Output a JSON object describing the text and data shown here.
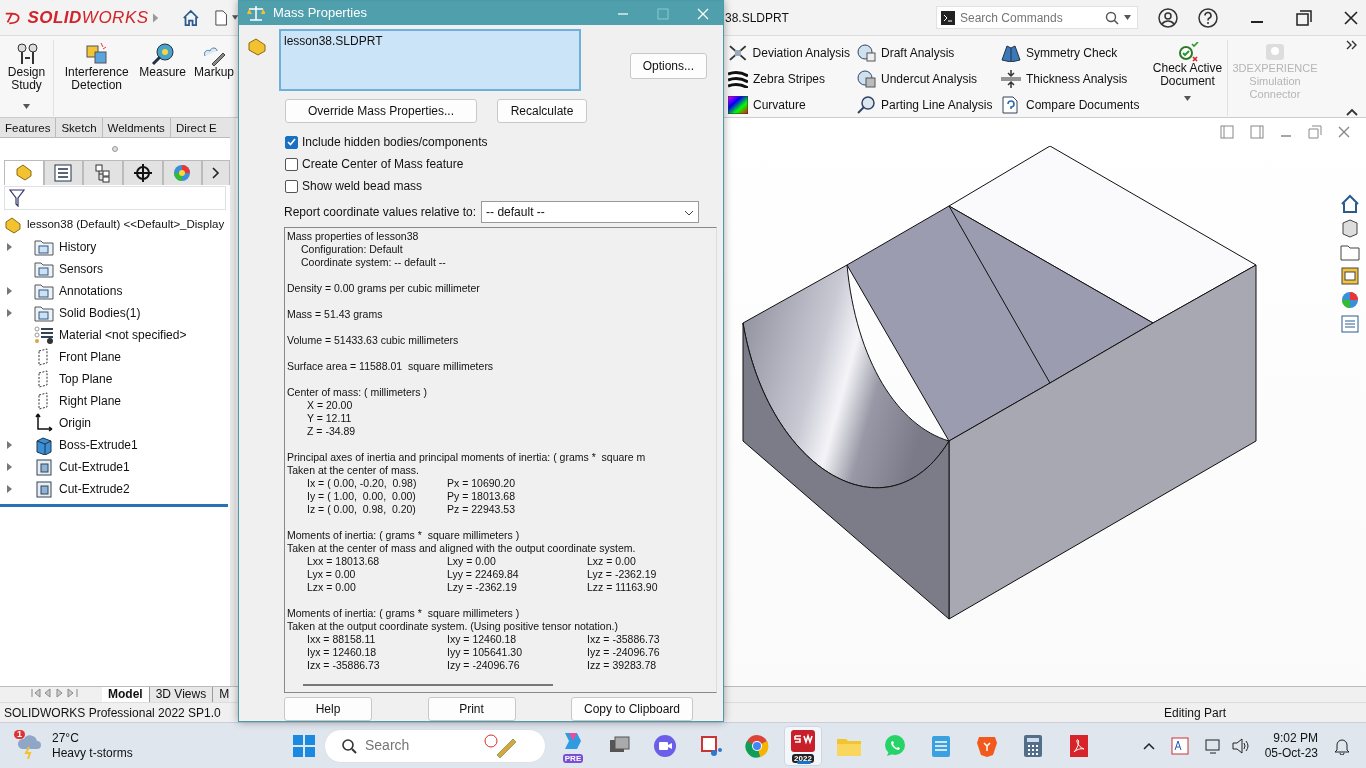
{
  "app": {
    "logo": "**SOLID**WORKS",
    "document_title": "38.SLDPRT",
    "search": {
      "placeholder": "Search Commands"
    }
  },
  "ribbon_left": [
    {
      "label": "Design Study",
      "dropdown": true
    },
    {
      "label": "Interference Detection",
      "dropdown": false
    },
    {
      "label": "Measure",
      "dropdown": false
    },
    {
      "label": "Markup",
      "dropdown": false
    }
  ],
  "ribbon_right": {
    "items": [
      "Deviation Analysis",
      "Zebra Stripes",
      "Curvature",
      "Draft Analysis",
      "Undercut Analysis",
      "Parting Line Analysis",
      "Symmetry Check",
      "Thickness Analysis",
      "Compare Documents"
    ],
    "check": {
      "label": "Check Active Document",
      "dropdown": true
    },
    "connector": {
      "label": "3DEXPERIENCE Simulation Connector",
      "disabled": true
    }
  },
  "command_tabs": [
    {
      "label": "Features",
      "selected": false
    },
    {
      "label": "Sketch",
      "selected": false
    },
    {
      "label": "Weldments",
      "selected": false
    },
    {
      "label": "Direct E",
      "selected": false
    }
  ],
  "tree_tabs": [
    {
      "selected": true
    },
    {
      "selected": false
    },
    {
      "selected": false
    },
    {
      "selected": false
    },
    {
      "selected": false
    }
  ],
  "feature_tree": {
    "root": "lesson38 (Default) <<Default>_Display",
    "items": [
      {
        "label": "History",
        "kind": "folder",
        "expandable": true
      },
      {
        "label": "Sensors",
        "kind": "folder",
        "expandable": false
      },
      {
        "label": "Annotations",
        "kind": "folder",
        "expandable": true
      },
      {
        "label": "Solid Bodies(1)",
        "kind": "folder",
        "expandable": true
      },
      {
        "label": "Material <not specified>",
        "kind": "material",
        "expandable": false
      },
      {
        "label": "Front Plane",
        "kind": "plane",
        "expandable": false
      },
      {
        "label": "Top Plane",
        "kind": "plane",
        "expandable": false
      },
      {
        "label": "Right Plane",
        "kind": "plane",
        "expandable": false
      },
      {
        "label": "Origin",
        "kind": "origin",
        "expandable": false
      },
      {
        "label": "Boss-Extrude1",
        "kind": "boss",
        "expandable": true
      },
      {
        "label": "Cut-Extrude1",
        "kind": "cut",
        "expandable": true
      },
      {
        "label": "Cut-Extrude2",
        "kind": "cut",
        "expandable": true
      }
    ]
  },
  "bottom_tabs": [
    {
      "label": "Model",
      "selected": true
    },
    {
      "label": "3D Views",
      "selected": false
    },
    {
      "label": "M",
      "selected": false
    }
  ],
  "status_bar": {
    "product": "SOLIDWORKS Professional 2022 SP1.0",
    "mode": "Editing Part"
  },
  "dialog": {
    "title": "Mass Properties",
    "selected_items": [
      "lesson38.SLDPRT"
    ],
    "options_button": "Options...",
    "override_button": "Override Mass Properties...",
    "recalculate_button": "Recalculate",
    "checkboxes": [
      {
        "label": "Include hidden bodies/components",
        "checked": true
      },
      {
        "label": "Create Center of Mass feature",
        "checked": false
      },
      {
        "label": "Show weld bead mass",
        "checked": false
      }
    ],
    "coordinate": {
      "label": "Report coordinate values relative to:",
      "value": "-- default --"
    },
    "report": [
      {
        "heading": [
          "Mass properties of lesson38"
        ],
        "rows": [
          [
            "Configuration: Default"
          ],
          [
            "Coordinate system: -- default --"
          ]
        ]
      },
      {
        "heading": [
          "Density = 0.00 grams per cubic millimeter"
        ]
      },
      {
        "heading": [
          "Mass = 51.43 grams"
        ]
      },
      {
        "heading": [
          "Volume = 51433.63 cubic millimeters"
        ]
      },
      {
        "heading": [
          "Surface area = 11588.01  square millimeters"
        ]
      },
      {
        "heading": [
          "Center of mass: ( millimeters )"
        ],
        "rows": [
          [
            "X = 20.00"
          ],
          [
            "Y = 12.11"
          ],
          [
            "Z = -34.89"
          ]
        ]
      },
      {
        "heading": [
          "Principal axes of inertia and principal moments of inertia: ( grams *  square m",
          "Taken at the center of mass."
        ],
        "rows": [
          [
            "Ix = ( 0.00, -0.20,  0.98)",
            "Px = 10690.20"
          ],
          [
            "Iy = ( 1.00,  0.00,  0.00)",
            "Py = 18013.68"
          ],
          [
            "Iz = ( 0.00,  0.98,  0.20)",
            "Pz = 22943.53"
          ]
        ]
      },
      {
        "heading": [
          "Moments of inertia: ( grams *  square millimeters )",
          "Taken at the center of mass and aligned with the output coordinate system."
        ],
        "rows": [
          [
            "Lxx = 18013.68",
            "Lxy = 0.00",
            "Lxz = 0.00"
          ],
          [
            "Lyx = 0.00",
            "Lyy = 22469.84",
            "Lyz = -2362.19"
          ],
          [
            "Lzx = 0.00",
            "Lzy = -2362.19",
            "Lzz = 11163.90"
          ]
        ]
      },
      {
        "heading": [
          "Moments of inertia: ( grams *  square millimeters )",
          "Taken at the output coordinate system. (Using positive tensor notation.)"
        ],
        "rows": [
          [
            "Ixx = 88158.11",
            "Ixy = 12460.18",
            "Ixz = -35886.73"
          ],
          [
            "Iyx = 12460.18",
            "Iyy = 105641.30",
            "Iyz = -24096.76"
          ],
          [
            "Izx = -35886.73",
            "Izy = -24096.76",
            "Izz = 39283.78"
          ]
        ]
      }
    ],
    "footer_buttons": [
      "Help",
      "Print",
      "Copy to Clipboard"
    ]
  },
  "taskbar": {
    "weather": {
      "badge": "1",
      "temperature": "27°C",
      "condition": "Heavy t-storms"
    },
    "search": {
      "placeholder": "Search"
    },
    "apps": [
      {
        "badge": "PRE",
        "selected": false
      },
      {
        "selected": false
      },
      {
        "selected": false
      },
      {
        "selected": false
      },
      {
        "selected": false
      },
      {
        "badge": "2022",
        "selected": true
      },
      {
        "selected": false
      },
      {
        "selected": false
      },
      {
        "selected": false
      },
      {
        "selected": false
      },
      {
        "selected": false
      },
      {
        "selected": false
      }
    ],
    "time": "9:02 PM",
    "date": "05-Oct-23"
  }
}
